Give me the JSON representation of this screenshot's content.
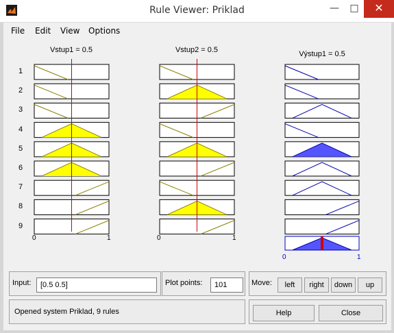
{
  "window": {
    "title": "Rule Viewer: Priklad"
  },
  "menu": [
    "File",
    "Edit",
    "View",
    "Options"
  ],
  "inputs": [
    {
      "header": "Vstup1 = 0.5",
      "value": 0.5,
      "tick_min": "0",
      "tick_max": "1"
    },
    {
      "header": "Vstup2 = 0.5",
      "value": 0.5,
      "tick_min": "0",
      "tick_max": "1"
    }
  ],
  "output": {
    "header": "Výstup1 = 0.5",
    "value": 0.5,
    "tick_min": "0",
    "tick_max": "1"
  },
  "rules": [
    {
      "num": "1",
      "in1": "low",
      "in1_active": false,
      "in2": "low",
      "in2_active": false,
      "out": "low",
      "out_fired": false
    },
    {
      "num": "2",
      "in1": "low",
      "in1_active": false,
      "in2": "mid",
      "in2_active": true,
      "out": "low",
      "out_fired": false
    },
    {
      "num": "3",
      "in1": "low",
      "in1_active": false,
      "in2": "high",
      "in2_active": false,
      "out": "mid",
      "out_fired": false
    },
    {
      "num": "4",
      "in1": "mid",
      "in1_active": true,
      "in2": "low",
      "in2_active": false,
      "out": "low",
      "out_fired": false
    },
    {
      "num": "5",
      "in1": "mid",
      "in1_active": true,
      "in2": "mid",
      "in2_active": true,
      "out": "mid",
      "out_fired": true
    },
    {
      "num": "6",
      "in1": "mid",
      "in1_active": true,
      "in2": "high",
      "in2_active": false,
      "out": "mid",
      "out_fired": false
    },
    {
      "num": "7",
      "in1": "high",
      "in1_active": false,
      "in2": "low",
      "in2_active": false,
      "out": "mid",
      "out_fired": false
    },
    {
      "num": "8",
      "in1": "high",
      "in1_active": false,
      "in2": "mid",
      "in2_active": true,
      "out": "high",
      "out_fired": false
    },
    {
      "num": "9",
      "in1": "high",
      "in1_active": false,
      "in2": "high",
      "in2_active": false,
      "out": "high",
      "out_fired": false
    }
  ],
  "controls": {
    "input_label": "Input:",
    "input_value": "[0.5 0.5]",
    "plot_points_label": "Plot points:",
    "plot_points_value": "101",
    "move_label": "Move:",
    "move_buttons": [
      "left",
      "right",
      "down",
      "up"
    ],
    "status": "Opened system Priklad, 9 rules",
    "help_label": "Help",
    "close_label": "Close"
  },
  "colors": {
    "input_fill": "#ffff00",
    "input_line": "#8b8000",
    "output_fill": "#5555ff",
    "output_line": "#0000aa",
    "index_line": "#cc0000"
  }
}
